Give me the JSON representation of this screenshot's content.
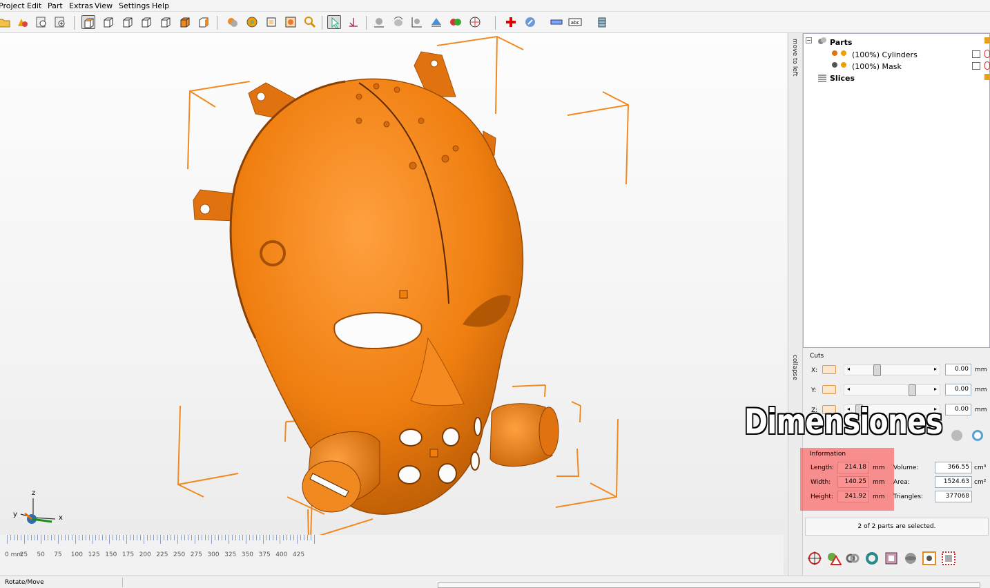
{
  "menu": [
    "Project",
    "Edit",
    "Part",
    "Extras",
    "View",
    "Settings",
    "Help"
  ],
  "side_tabs": {
    "top": "move to left",
    "bottom": "collapse"
  },
  "tree": {
    "parts_label": "Parts",
    "items": [
      "(100%) Cylinders",
      "(100%) Mask"
    ],
    "slices_label": "Slices"
  },
  "cuts": {
    "title": "Cuts",
    "x_label": "X:",
    "y_label": "Y:",
    "z_label": "Z:",
    "x_value": "0.00",
    "y_value": "0.00",
    "z_value": "0.00",
    "unit": "mm"
  },
  "overlay_text": "Dimensiones",
  "information": {
    "title": "Information",
    "length_label": "Length:",
    "length_value": "214.18",
    "width_label": "Width:",
    "width_value": "140.25",
    "height_label": "Height:",
    "height_value": "241.92",
    "mm": "mm",
    "volume_label": "Volume:",
    "volume_value": "366.55",
    "volume_unit": "cm³",
    "area_label": "Area:",
    "area_value": "1524.63",
    "area_unit": "cm²",
    "triangles_label": "Triangles:",
    "triangles_value": "377068"
  },
  "selection_status": "2 of 2 parts are selected.",
  "ruler": {
    "labels": [
      "0 mm",
      "25",
      "50",
      "75",
      "100",
      "125",
      "150",
      "175",
      "200",
      "225",
      "250",
      "275",
      "300",
      "325",
      "350",
      "375",
      "400",
      "425"
    ]
  },
  "axes": {
    "x": "x",
    "y": "y",
    "z": "z"
  },
  "statusbar": {
    "text": "Rotate/Move"
  },
  "colors": {
    "model": "#f07f10",
    "bbox": "#f08a20",
    "highlight": "#ff3c3c"
  },
  "toolbar_icons": [
    "open-icon",
    "shapes-icon",
    "import-icon",
    "add-icon",
    "view-iso-icon",
    "view-front-icon",
    "view-back-icon",
    "view-left-icon",
    "view-right-icon",
    "view-top-icon",
    "view-bottom-icon",
    "render-solid-icon",
    "render-shaded-icon",
    "render-wire-icon",
    "render-mixed-icon",
    "zoom-icon",
    "select-icon",
    "move-icon",
    "place-icon",
    "rotate-icon",
    "scale-icon",
    "mirror-icon",
    "color-icon",
    "section-icon",
    "add-part-icon",
    "fix-icon",
    "measure-icon",
    "text-icon",
    "slice-icon"
  ]
}
